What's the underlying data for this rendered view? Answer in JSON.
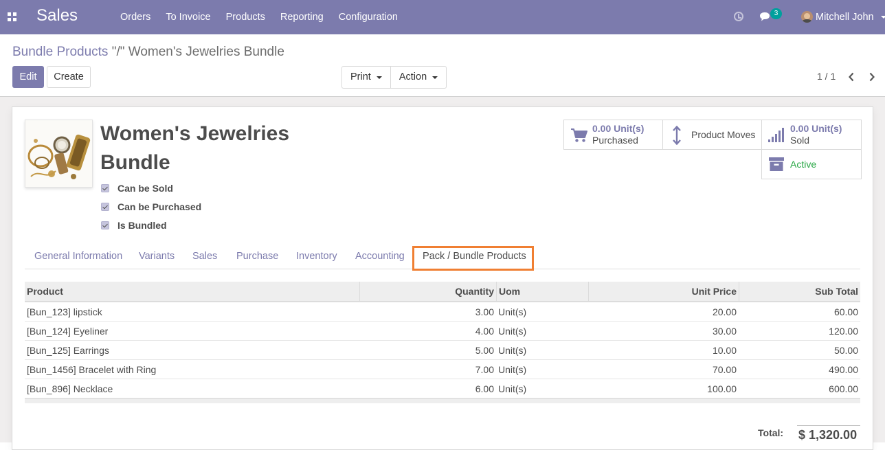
{
  "navbar": {
    "brand": "Sales",
    "menu": [
      "Orders",
      "To Invoice",
      "Products",
      "Reporting",
      "Configuration"
    ],
    "chat_count": "3",
    "user_name": "Mitchell John"
  },
  "control": {
    "breadcrumb_parent": "Bundle Products",
    "breadcrumb_current": "\"/\" Women's Jewelries Bundle",
    "edit_label": "Edit",
    "create_label": "Create",
    "print_label": "Print",
    "action_label": "Action",
    "pager": "1 / 1"
  },
  "form": {
    "title": "Women's Jewelries Bundle",
    "checks": [
      {
        "label": "Can be Sold",
        "checked": true
      },
      {
        "label": "Can be Purchased",
        "checked": true
      },
      {
        "label": "Is Bundled",
        "checked": true
      }
    ]
  },
  "smart_buttons": {
    "purchased_value": "0.00 Unit(s)",
    "purchased_label": "Purchased",
    "moves_label": "Product Moves",
    "sold_value": "0.00 Unit(s)",
    "sold_label": "Sold",
    "active_label": "Active"
  },
  "tabs": [
    "General Information",
    "Variants",
    "Sales",
    "Purchase",
    "Inventory",
    "Accounting",
    "Pack / Bundle Products"
  ],
  "active_tab": "Pack / Bundle Products",
  "table": {
    "headers": [
      "Product",
      "Quantity",
      "Uom",
      "Unit Price",
      "Sub Total"
    ],
    "rows": [
      [
        "[Bun_123] lipstick",
        "3.00",
        "Unit(s)",
        "20.00",
        "60.00"
      ],
      [
        "[Bun_124] Eyeliner",
        "4.00",
        "Unit(s)",
        "30.00",
        "120.00"
      ],
      [
        "[Bun_125] Earrings",
        "5.00",
        "Unit(s)",
        "10.00",
        "50.00"
      ],
      [
        "[Bun_1456] Bracelet with Ring",
        "7.00",
        "Unit(s)",
        "70.00",
        "490.00"
      ],
      [
        "[Bun_896] Necklace",
        "6.00",
        "Unit(s)",
        "100.00",
        "600.00"
      ]
    ],
    "total_label": "Total:",
    "total_value": "$ 1,320.00"
  },
  "colors": {
    "brand": "#7c7bad",
    "active_status": "#28a745",
    "highlight": "#f07f32"
  }
}
